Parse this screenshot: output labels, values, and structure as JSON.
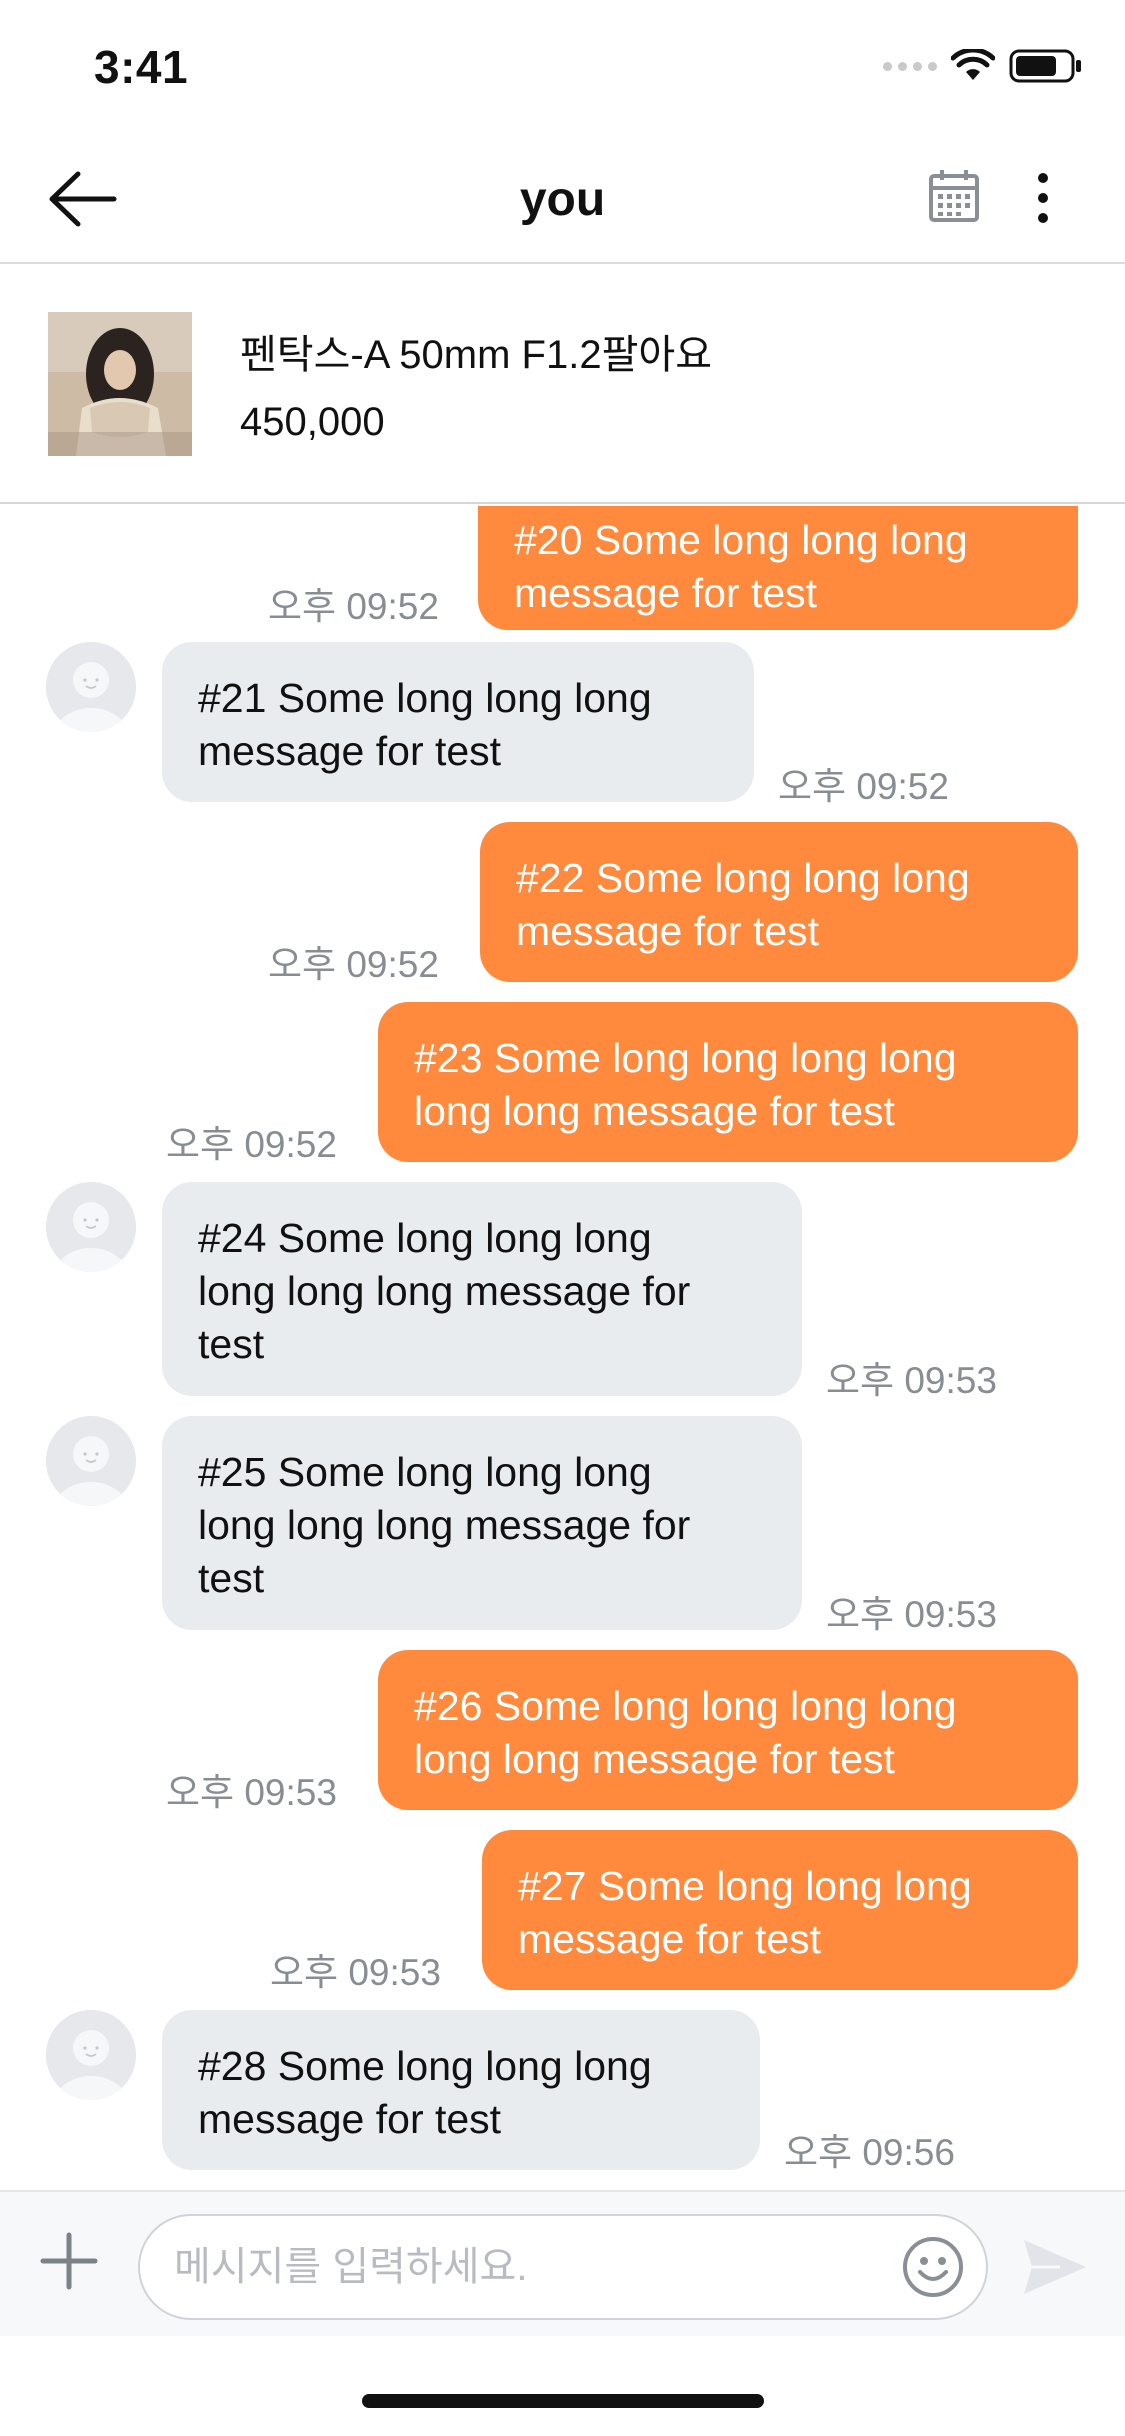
{
  "status_bar": {
    "time": "3:41"
  },
  "header": {
    "title": "you",
    "back_icon": "arrow-left-icon",
    "calendar_icon": "calendar-icon",
    "more_icon": "more-vertical-icon"
  },
  "product": {
    "title": "펜탁스-A 50mm F1.2팔아요",
    "price": "450,000"
  },
  "messages": [
    {
      "id": 20,
      "side": "mine",
      "lines": [
        "#20 Some long long long",
        "message for test"
      ],
      "time": "오후 09:52"
    },
    {
      "id": 21,
      "side": "theirs",
      "lines": [
        "#21 Some long long long",
        "message for test"
      ],
      "time": "오후 09:52"
    },
    {
      "id": 22,
      "side": "mine",
      "lines": [
        "#22 Some long long long",
        "message for test"
      ],
      "time": "오후 09:52"
    },
    {
      "id": 23,
      "side": "mine",
      "lines": [
        "#23 Some long long long long",
        "long long message for test"
      ],
      "time": "오후 09:52"
    },
    {
      "id": 24,
      "side": "theirs",
      "lines": [
        "#24 Some long long long",
        "long long long message for",
        "test"
      ],
      "time": "오후 09:53"
    },
    {
      "id": 25,
      "side": "theirs",
      "lines": [
        "#25 Some long long long",
        "long long long message for",
        "test"
      ],
      "time": "오후 09:53"
    },
    {
      "id": 26,
      "side": "mine",
      "lines": [
        "#26 Some long long long long",
        "long long message for test"
      ],
      "time": "오후 09:53"
    },
    {
      "id": 27,
      "side": "mine",
      "lines": [
        "#27 Some long long long",
        "message for test"
      ],
      "time": "오후 09:53"
    },
    {
      "id": 28,
      "side": "theirs",
      "lines": [
        "#28 Some long long long",
        "message for test"
      ],
      "time": "오후 09:56"
    }
  ],
  "input": {
    "placeholder": "메시지를 입력하세요.",
    "value": "",
    "plus_icon": "plus-icon",
    "emoji_icon": "smiley-icon",
    "send_icon": "send-icon"
  },
  "colors": {
    "mine_bubble": "#ff8a3d",
    "theirs_bubble": "#e9ecef",
    "timestamp": "#888d94"
  }
}
